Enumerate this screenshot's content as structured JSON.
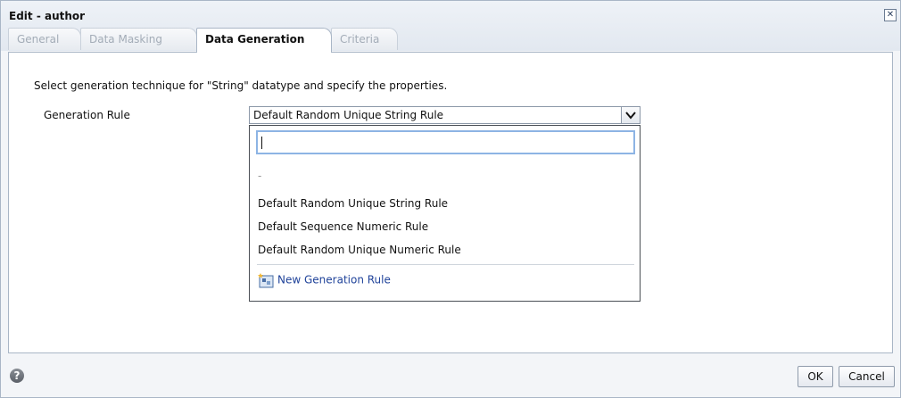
{
  "dialog": {
    "title": "Edit - author",
    "close_label": "✕"
  },
  "tabs": [
    {
      "label": "General",
      "active": false
    },
    {
      "label": "Data Masking",
      "active": false
    },
    {
      "label": "Data Generation",
      "active": true
    },
    {
      "label": "Criteria",
      "active": false
    }
  ],
  "panel": {
    "instructions": "Select generation technique for \"String\" datatype and specify the properties.",
    "generation_rule_label": "Generation Rule",
    "generation_rule_value": "Default Random Unique String Rule"
  },
  "dropdown": {
    "search_value": "",
    "empty_option": "-",
    "options": [
      "Default Random Unique String Rule",
      "Default Sequence Numeric Rule",
      "Default Random Unique Numeric Rule"
    ],
    "new_rule_label": "New Generation Rule",
    "new_rule_icon": "new-rule-icon"
  },
  "footer": {
    "help_icon": "help-icon",
    "help_glyph": "?",
    "ok_label": "OK",
    "cancel_label": "Cancel"
  },
  "colors": {
    "link": "#20439a",
    "focus_border": "#8db4e4",
    "dialog_border": "#a9b6c6"
  }
}
